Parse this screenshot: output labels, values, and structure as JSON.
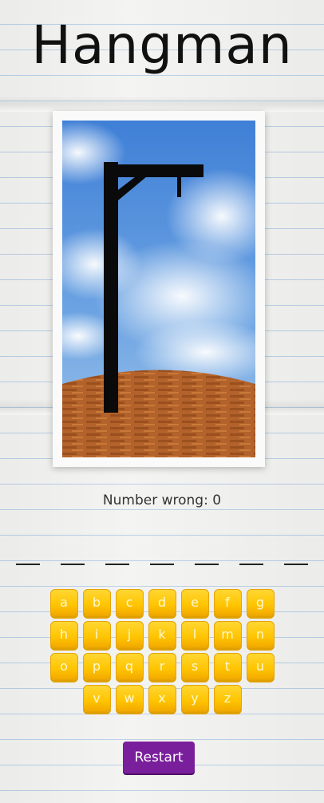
{
  "title": "Hangman",
  "status": {
    "label": "Number wrong: 0"
  },
  "word": {
    "letters": [
      "",
      "",
      "",
      "",
      "",
      "",
      ""
    ]
  },
  "keyboard": {
    "rows": [
      [
        "a",
        "b",
        "c",
        "d",
        "e",
        "f",
        "g"
      ],
      [
        "h",
        "i",
        "j",
        "k",
        "l",
        "m",
        "n"
      ],
      [
        "o",
        "p",
        "q",
        "r",
        "s",
        "t",
        "u"
      ],
      [
        "v",
        "w",
        "x",
        "y",
        "z"
      ]
    ]
  },
  "restart_label": "Restart",
  "colors": {
    "key": "#ffc400",
    "restart": "#7a1f9c",
    "sky": "#4f8fdc",
    "hill": "#b5652a",
    "gallows": "#0a0a0a"
  }
}
